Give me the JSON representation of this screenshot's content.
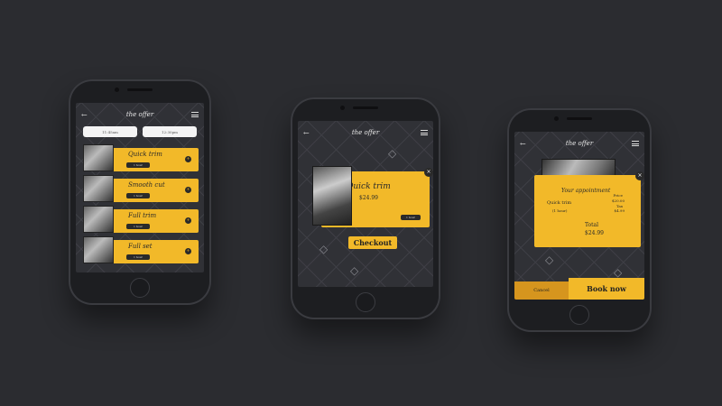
{
  "app": {
    "logo": "the offer"
  },
  "phone1": {
    "tabs": [
      "11:45am",
      "12:30pm"
    ],
    "services": [
      {
        "title": "Quick trim",
        "pill": "1 hour"
      },
      {
        "title": "Smooth cut",
        "pill": "1 hour"
      },
      {
        "title": "Full trim",
        "pill": "1 hour"
      },
      {
        "title": "Full set",
        "pill": "1 hour"
      }
    ]
  },
  "phone2": {
    "title": "Quick trim",
    "price": "$24.99",
    "pill": "1 hour",
    "checkout_label": "Checkout"
  },
  "phone3": {
    "heading": "Your appointment",
    "service": "Quick trim",
    "duration": "(1 hour)",
    "price_label": "Price",
    "price_value": "$20.00",
    "tax_label": "Tax",
    "tax_value": "$4.99",
    "total_label": "Total",
    "total_value": "$24.99",
    "cancel_label": "Cancel",
    "book_label": "Book now"
  },
  "icons": {
    "back": "arrow-left-icon",
    "menu": "hamburger-menu-icon",
    "close": "close-icon",
    "add": "plus-icon",
    "diamond": "diamond-icon"
  },
  "colors": {
    "accent": "#f2b929",
    "background": "#2b2c30",
    "screen": "#303136"
  }
}
